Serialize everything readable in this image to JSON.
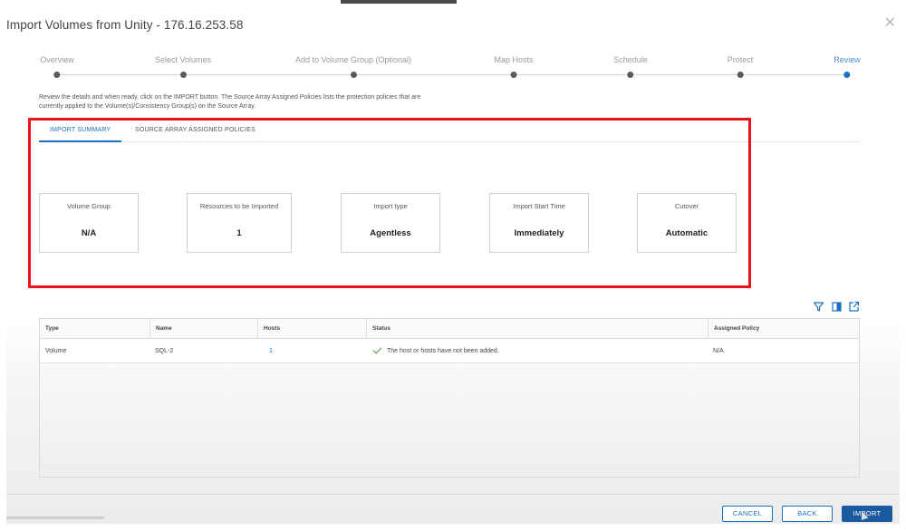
{
  "dialog": {
    "title": "Import Volumes from Unity - 176.16.253.58",
    "close_icon": "close-icon"
  },
  "wizard": {
    "steps": [
      {
        "label": "Overview",
        "active": false
      },
      {
        "label": "Select Volumes",
        "active": false
      },
      {
        "label": "Add to Volume Group (Optional)",
        "active": false
      },
      {
        "label": "Map Hosts",
        "active": false
      },
      {
        "label": "Schedule",
        "active": false
      },
      {
        "label": "Protect",
        "active": false
      },
      {
        "label": "Review",
        "active": true
      }
    ]
  },
  "intro": {
    "line1": "Review the details and when ready, click on the IMPORT button. The Source Array Assigned Policies lists the protection policies that are",
    "line2": "currently applied to the Volume(s)/Consistency Group(s) on the Source Array."
  },
  "tabs": [
    {
      "label": "IMPORT SUMMARY",
      "active": true
    },
    {
      "label": "SOURCE ARRAY ASSIGNED POLICIES",
      "active": false
    }
  ],
  "summary_cards": [
    {
      "label": "Volume Group",
      "value": "N/A"
    },
    {
      "label": "Resources to be Imported",
      "value": "1"
    },
    {
      "label": "Import type",
      "value": "Agentless"
    },
    {
      "label": "Import Start Time",
      "value": "Immediately"
    },
    {
      "label": "Cutover",
      "value": "Automatic"
    }
  ],
  "toolbar": {
    "icons": [
      "filter-icon",
      "columns-icon",
      "export-icon"
    ]
  },
  "table": {
    "columns": [
      "Type",
      "Name",
      "Hosts",
      "Status",
      "Assigned Policy"
    ],
    "rows": [
      {
        "type": "Volume",
        "name": "SQL-2",
        "hosts": "1",
        "status": "The host or hosts have not been added.",
        "status_icon": "check-icon",
        "policy": "N/A"
      }
    ]
  },
  "footer": {
    "cancel_label": "CANCEL",
    "back_label": "BACK",
    "import_label": "IMPORT"
  },
  "colors": {
    "accent": "#1b6fbf",
    "highlight": "#e8141a",
    "success": "#3f9c35"
  }
}
